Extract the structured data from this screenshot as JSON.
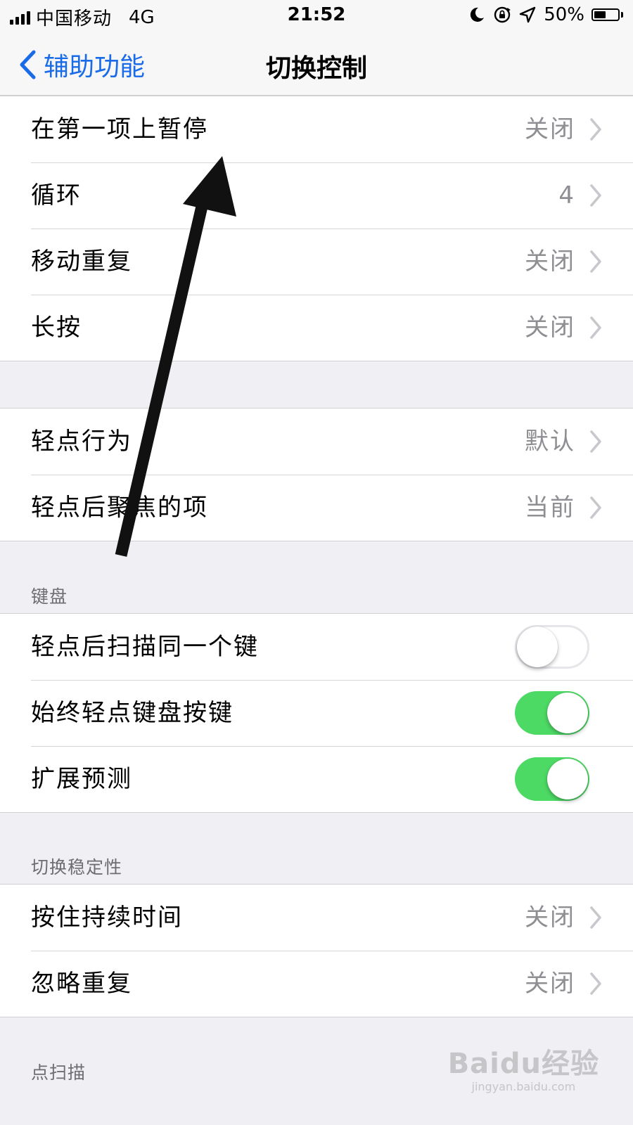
{
  "status_bar": {
    "carrier": "中国移动",
    "network": "4G",
    "time": "21:52",
    "battery": "50%",
    "battery_level": 0.5,
    "icons": [
      "signal-icon",
      "moon-icon",
      "rotation-lock-icon",
      "location-icon",
      "battery-icon"
    ]
  },
  "nav": {
    "back_label": "辅助功能",
    "title": "切换控制"
  },
  "group1": {
    "rows": [
      {
        "label": "在第一项上暂停",
        "value": "关闭"
      },
      {
        "label": "循环",
        "value": "4"
      },
      {
        "label": "移动重复",
        "value": "关闭"
      },
      {
        "label": "长按",
        "value": "关闭"
      }
    ]
  },
  "group2": {
    "rows": [
      {
        "label": "轻点行为",
        "value": "默认"
      },
      {
        "label": "轻点后聚焦的项",
        "value": "当前"
      }
    ]
  },
  "keyboard": {
    "header": "键盘",
    "rows": [
      {
        "label": "轻点后扫描同一个键",
        "on": false
      },
      {
        "label": "始终轻点键盘按键",
        "on": true
      },
      {
        "label": "扩展预测",
        "on": true
      }
    ]
  },
  "stability": {
    "header": "切换稳定性",
    "rows": [
      {
        "label": "按住持续时间",
        "value": "关闭"
      },
      {
        "label": "忽略重复",
        "value": "关闭"
      }
    ]
  },
  "point_scan": {
    "header": "点扫描"
  },
  "colors": {
    "accent": "#1a6be8",
    "toggle_on": "#4cd964",
    "background": "#efeff4",
    "secondary_text": "#8e8e93"
  },
  "watermark": {
    "logo": "Baidu经验",
    "url": "jingyan.baidu.com"
  }
}
